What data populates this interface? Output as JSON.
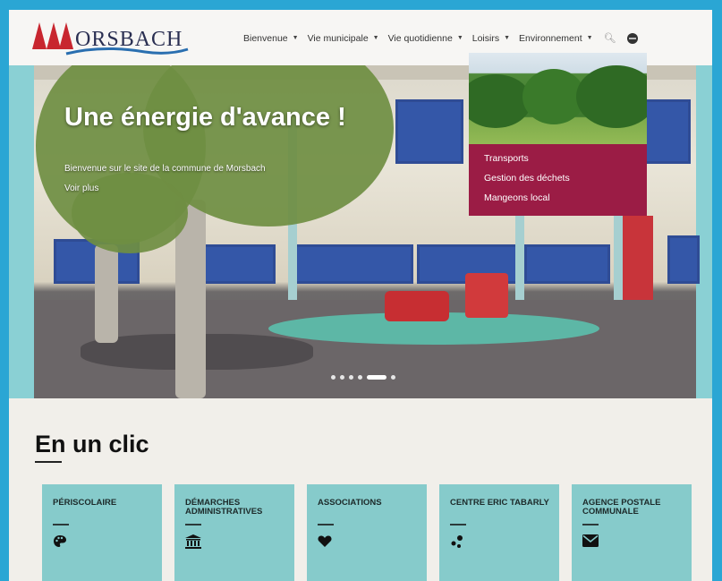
{
  "brand": {
    "name": "ORSBACH"
  },
  "nav": {
    "items": [
      {
        "label": "Bienvenue"
      },
      {
        "label": "Vie municipale"
      },
      {
        "label": "Vie quotidienne"
      },
      {
        "label": "Loisirs"
      },
      {
        "label": "Environnement"
      }
    ],
    "search_icon": "search-icon",
    "language_icon": "globe-icon"
  },
  "dropdown": {
    "parent": "Environnement",
    "items": [
      {
        "label": "Transports"
      },
      {
        "label": "Gestion des déchets"
      },
      {
        "label": "Mangeons local"
      }
    ]
  },
  "hero": {
    "title": "Une énergie d'avance !",
    "subtitle": "Bienvenue sur le site de la commune de Morsbach",
    "more": "Voir plus",
    "slides": 6,
    "active_slide": 4
  },
  "section": {
    "title": "En un clic",
    "cards": [
      {
        "label": "Périscolaire",
        "icon": "palette-icon"
      },
      {
        "label": "Démarches administratives",
        "icon": "institution-icon"
      },
      {
        "label": "Associations",
        "icon": "heart-icon"
      },
      {
        "label": "Centre Eric Tabarly",
        "icon": "molecule-icon"
      },
      {
        "label": "Agence postale communale",
        "icon": "envelope-icon"
      }
    ]
  },
  "colors": {
    "frame": "#2aa6d4",
    "dropdown": "#9b1c45",
    "card": "#86cbcb",
    "brand_red": "#c8262f",
    "brand_navy": "#2a2f52"
  }
}
